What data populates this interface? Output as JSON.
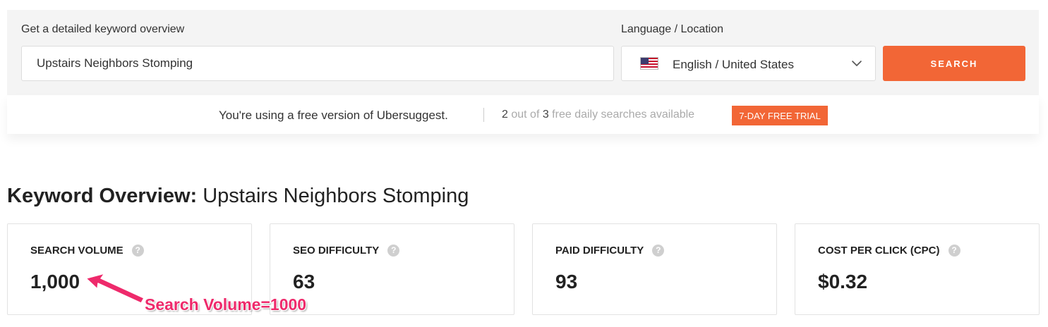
{
  "search": {
    "keyword_label": "Get a detailed keyword overview",
    "keyword_value": "Upstairs Neighbors Stomping",
    "language_label": "Language / Location",
    "language_value": "English / United States",
    "search_button": "SEARCH"
  },
  "free_bar": {
    "message": "You're using a free version of Ubersuggest.",
    "searches_used": "2",
    "searches_out_of": " out of ",
    "searches_total": "3",
    "searches_suffix": " free daily searches available",
    "trial_button": "7-DAY FREE TRIAL"
  },
  "overview": {
    "title_prefix": "Keyword Overview:",
    "title_keyword": " Upstairs Neighbors Stomping"
  },
  "metrics": [
    {
      "label": "SEARCH VOLUME",
      "value": "1,000"
    },
    {
      "label": "SEO DIFFICULTY",
      "value": "63"
    },
    {
      "label": "PAID DIFFICULTY",
      "value": "93"
    },
    {
      "label": "COST PER CLICK (CPC)",
      "value": "$0.32"
    }
  ],
  "help_icon_glyph": "?",
  "annotation": {
    "text": "Search Volume=1000",
    "color": "#ee2a6b"
  },
  "colors": {
    "accent": "#f26636",
    "panel_bg": "#f4f4f4"
  }
}
